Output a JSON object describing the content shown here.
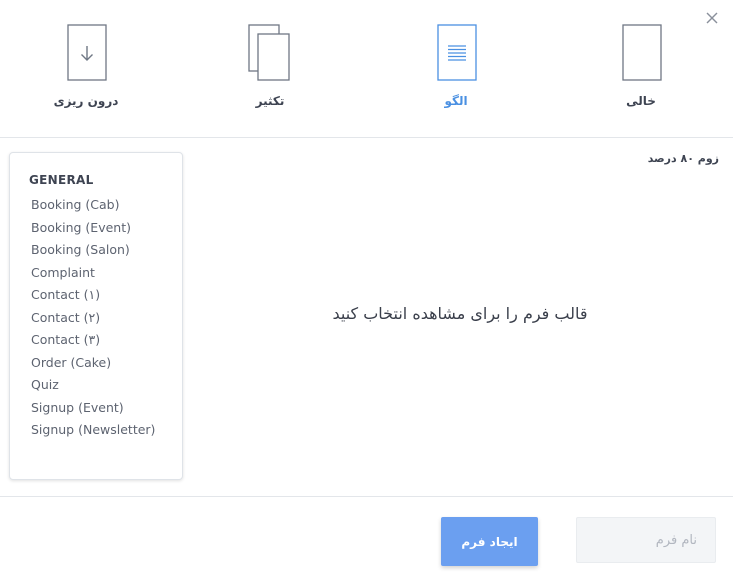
{
  "colors": {
    "accent": "#4a90e2",
    "primary_button": "#6b9ff0",
    "icon_stroke": "#6f7784"
  },
  "type_options": [
    {
      "label": "خالی",
      "icon": "blank-page-icon",
      "active": false
    },
    {
      "label": "الگو",
      "icon": "template-page-icon",
      "active": true
    },
    {
      "label": "تکثیر",
      "icon": "duplicate-pages-icon",
      "active": false
    },
    {
      "label": "درون ریزی",
      "icon": "import-download-icon",
      "active": false
    }
  ],
  "zoom_label": "زوم ۸۰ درصد",
  "preview_message": "قالب فرم را برای مشاهده انتخاب کنید",
  "template_list": {
    "group_title": "GENERAL",
    "items": [
      "Booking (Cab)",
      "Booking (Event)",
      "Booking (Salon)",
      "Complaint",
      "Contact (۱)",
      "Contact (۲)",
      "Contact (۳)",
      "Order (Cake)",
      "Quiz",
      "Signup (Event)",
      "Signup (Newsletter)"
    ]
  },
  "footer": {
    "create_button_label": "ایجاد فرم",
    "name_placeholder": "نام فرم"
  }
}
